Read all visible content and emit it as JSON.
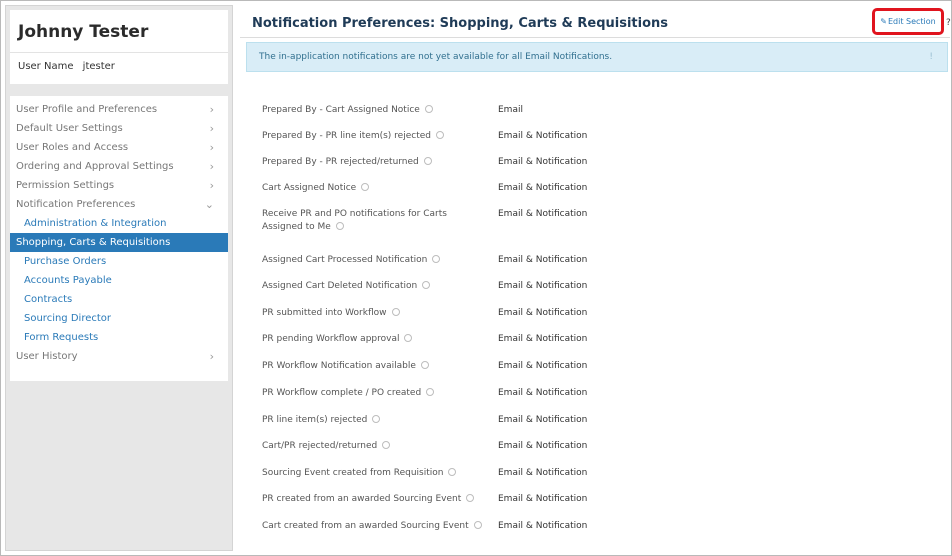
{
  "sidebar": {
    "user_full_name": "Johnny Tester",
    "username_label": "User Name",
    "username_value": "jtester",
    "nav": [
      {
        "label": "User Profile and Preferences"
      },
      {
        "label": "Default User Settings"
      },
      {
        "label": "User Roles and Access"
      },
      {
        "label": "Ordering and Approval Settings"
      },
      {
        "label": "Permission Settings"
      },
      {
        "label": "Notification Preferences"
      },
      {
        "label": "Administration & Integration"
      },
      {
        "label": "Shopping, Carts & Requisitions"
      },
      {
        "label": "Purchase Orders"
      },
      {
        "label": "Accounts Payable"
      },
      {
        "label": "Contracts"
      },
      {
        "label": "Sourcing Director"
      },
      {
        "label": "Form Requests"
      },
      {
        "label": "User History"
      }
    ]
  },
  "header": {
    "title": "Notification Preferences:  Shopping, Carts & Requisitions",
    "edit_label": "Edit Section",
    "help": "?"
  },
  "banner": {
    "text": "The in-application notifications are not yet available for all Email Notifications."
  },
  "preferences": [
    {
      "label": "Prepared By - Cart Assigned Notice",
      "value": "Email"
    },
    {
      "label": "Prepared By - PR line item(s) rejected",
      "value": "Email & Notification"
    },
    {
      "label": "Prepared By - PR rejected/returned",
      "value": "Email & Notification"
    },
    {
      "label": "Cart Assigned Notice",
      "value": "Email & Notification"
    },
    {
      "label": "Receive PR and PO notifications for Carts",
      "label2": "Assigned to Me",
      "value": "Email & Notification"
    },
    {
      "label": "Assigned Cart Processed Notification",
      "value": "Email & Notification"
    },
    {
      "label": "Assigned Cart Deleted Notification",
      "value": "Email & Notification"
    },
    {
      "label": "PR submitted into Workflow",
      "value": "Email & Notification"
    },
    {
      "label": "PR pending Workflow approval",
      "value": "Email & Notification"
    },
    {
      "label": "PR Workflow Notification available",
      "value": "Email & Notification"
    },
    {
      "label": "PR Workflow complete / PO created",
      "value": "Email & Notification"
    },
    {
      "label": "PR line item(s) rejected",
      "value": "Email & Notification"
    },
    {
      "label": "Cart/PR rejected/returned",
      "value": "Email & Notification"
    },
    {
      "label": "Sourcing Event created from Requisition",
      "value": "Email & Notification"
    },
    {
      "label": "PR created from an awarded Sourcing Event",
      "value": "Email & Notification"
    },
    {
      "label": "Cart created from an awarded Sourcing Event",
      "value": "Email & Notification"
    }
  ]
}
